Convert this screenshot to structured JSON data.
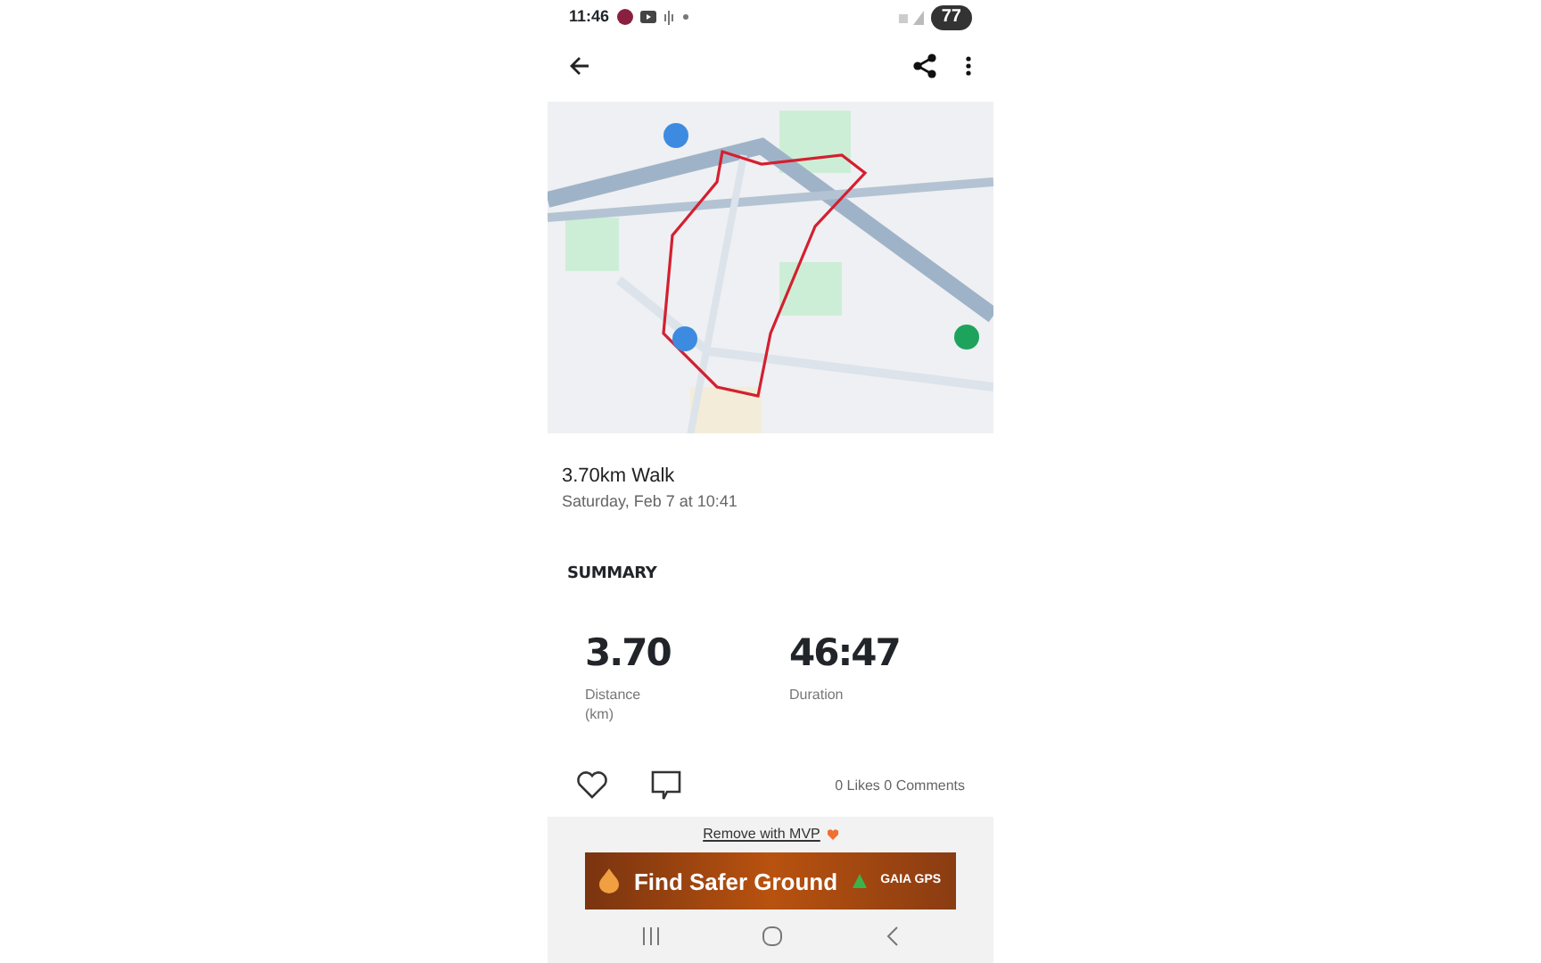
{
  "status_bar": {
    "time": "11:46",
    "battery": "77"
  },
  "activity": {
    "title": "3.70km Walk",
    "subtitle": "Saturday, Feb 7 at 10:41"
  },
  "summary": {
    "heading": "SUMMARY",
    "stats": [
      {
        "value": "3.70",
        "label": "Distance\n(km)"
      },
      {
        "value": "46:47",
        "label": "Duration"
      }
    ]
  },
  "social": {
    "counts": "0 Likes 0 Comments"
  },
  "ad": {
    "remove_link": "Remove with MVP",
    "headline": "Find Safer Ground",
    "brand": "GAIA GPS"
  }
}
